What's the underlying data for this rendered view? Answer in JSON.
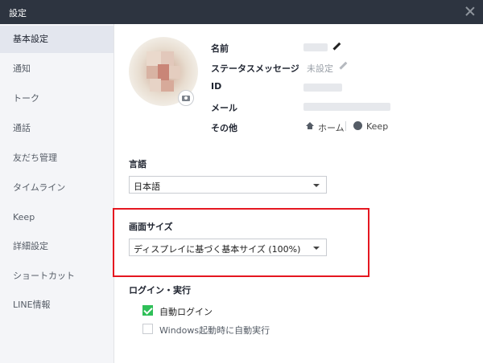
{
  "window": {
    "title": "設定"
  },
  "sidebar": {
    "items": [
      {
        "label": "基本設定"
      },
      {
        "label": "通知"
      },
      {
        "label": "トーク"
      },
      {
        "label": "通話"
      },
      {
        "label": "友だち管理"
      },
      {
        "label": "タイムライン"
      },
      {
        "label": "Keep"
      },
      {
        "label": "詳細設定"
      },
      {
        "label": "ショートカット"
      },
      {
        "label": "LINE情報"
      }
    ]
  },
  "profile": {
    "name_label": "名前",
    "status_label": "ステータスメッセージ",
    "status_value": "未設定",
    "id_label": "ID",
    "mail_label": "メール",
    "other_label": "その他",
    "home_link": "ホーム",
    "keep_link": "Keep"
  },
  "language": {
    "title": "言語",
    "selected": "日本語"
  },
  "screen_size": {
    "title": "画面サイズ",
    "selected": "ディスプレイに基づく基本サイズ (100%)"
  },
  "login": {
    "title": "ログイン・実行",
    "auto_login_label": "自動ログイン",
    "auto_login_checked": true,
    "startup_label": "Windows起動時に自動実行",
    "startup_checked": false
  },
  "colors": {
    "titlebar": "#2d3440",
    "highlight": "#e51720",
    "check": "#2fbf58"
  }
}
